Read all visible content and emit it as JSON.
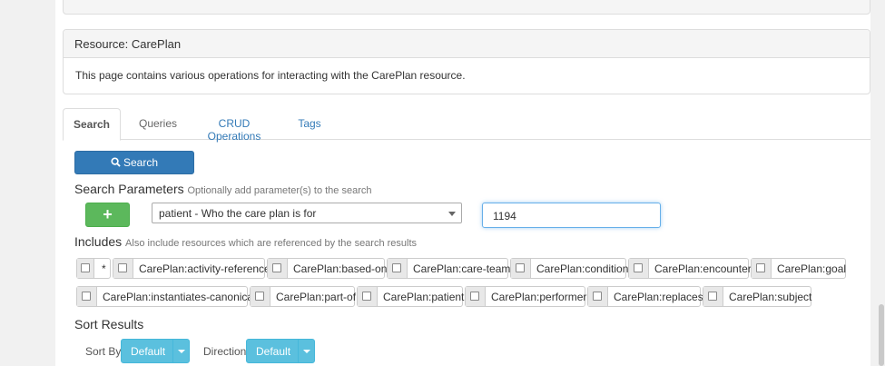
{
  "resource_panel": {
    "title": "Resource: CarePlan",
    "description": "This page contains various operations for interacting with the CarePlan resource."
  },
  "tabs": [
    {
      "label": "Search",
      "active": true
    },
    {
      "label": "Queries",
      "active": false
    },
    {
      "label": "CRUD Operations",
      "active": false
    },
    {
      "label": "Tags",
      "active": false
    }
  ],
  "search_button": {
    "label": "Search",
    "icon": "search-icon"
  },
  "search_params": {
    "title": "Search Parameters",
    "hint": "Optionally add parameter(s) to the search",
    "add_button_label": "+",
    "param_select_value": "patient - Who the care plan is for",
    "param_value": "1194"
  },
  "includes": {
    "title": "Includes",
    "hint": "Also include resources which are referenced by the search results",
    "items": [
      "*",
      "CarePlan:activity-reference",
      "CarePlan:based-on",
      "CarePlan:care-team",
      "CarePlan:condition",
      "CarePlan:encounter",
      "CarePlan:goal",
      "CarePlan:instantiates-canonical",
      "CarePlan:part-of",
      "CarePlan:patient",
      "CarePlan:performer",
      "CarePlan:replaces",
      "CarePlan:subject"
    ]
  },
  "sort": {
    "title": "Sort Results",
    "sort_by_label": "Sort By",
    "sort_by_value": "Default",
    "direction_label": "Direction",
    "direction_value": "Default"
  },
  "colors": {
    "primary": "#337ab7",
    "success": "#5cb85c",
    "info": "#5bc0de"
  }
}
